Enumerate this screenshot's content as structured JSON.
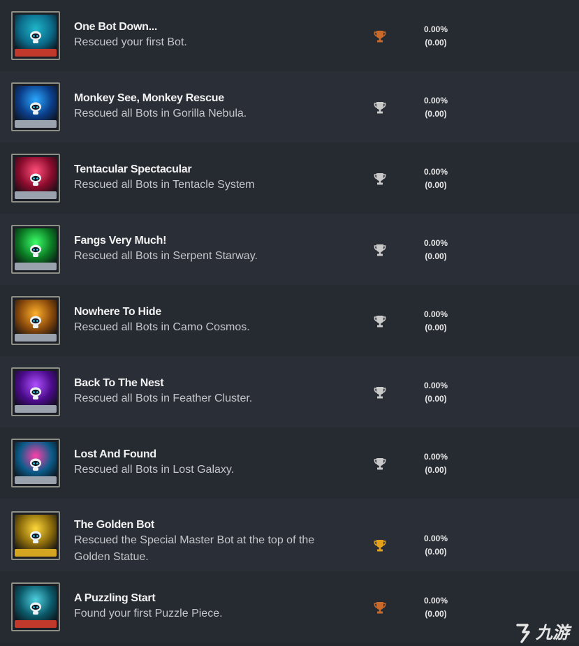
{
  "achievements": [
    {
      "title": "One Bot Down...",
      "description": "Rescued your first Bot.",
      "trophy": "bronze",
      "trophy_icon": "trophy-icon",
      "percent": "0.00%",
      "points": "(0.00)",
      "art_colors": [
        "#0b6b8a",
        "#1fb5c9"
      ],
      "base_color": "#c0392b"
    },
    {
      "title": "Monkey See, Monkey Rescue",
      "description": "Rescued all Bots in Gorilla Nebula.",
      "trophy": "silver",
      "trophy_icon": "trophy-icon",
      "percent": "0.00%",
      "points": "(0.00)",
      "art_colors": [
        "#0b3e8a",
        "#2aa8ff"
      ],
      "base_color": "#9aa3ad"
    },
    {
      "title": "Tentacular Spectacular",
      "description": "Rescued all Bots in Tentacle System",
      "trophy": "silver",
      "trophy_icon": "trophy-icon",
      "percent": "0.00%",
      "points": "(0.00)",
      "art_colors": [
        "#8a0b2c",
        "#ff4f7a"
      ],
      "base_color": "#9aa3ad"
    },
    {
      "title": "Fangs Very Much!",
      "description": "Rescued all Bots in Serpent Starway.",
      "trophy": "silver",
      "trophy_icon": "trophy-icon",
      "percent": "0.00%",
      "points": "(0.00)",
      "art_colors": [
        "#0b7a23",
        "#3cff6a"
      ],
      "base_color": "#9aa3ad"
    },
    {
      "title": "Nowhere To Hide",
      "description": "Rescued all Bots in Camo Cosmos.",
      "trophy": "silver",
      "trophy_icon": "trophy-icon",
      "percent": "0.00%",
      "points": "(0.00)",
      "art_colors": [
        "#8a4a0b",
        "#ffb02a"
      ],
      "base_color": "#9aa3ad"
    },
    {
      "title": "Back To The Nest",
      "description": "Rescued all Bots in Feather Cluster.",
      "trophy": "silver",
      "trophy_icon": "trophy-icon",
      "percent": "0.00%",
      "points": "(0.00)",
      "art_colors": [
        "#4a0b8a",
        "#b04fff"
      ],
      "base_color": "#9aa3ad"
    },
    {
      "title": "Lost And Found",
      "description": "Rescued all Bots in Lost Galaxy.",
      "trophy": "silver",
      "trophy_icon": "trophy-icon",
      "percent": "0.00%",
      "points": "(0.00)",
      "art_colors": [
        "#0b5c8a",
        "#ff3fa8"
      ],
      "base_color": "#9aa3ad"
    },
    {
      "title": "The Golden Bot",
      "description": "Rescued the Special Master Bot at the top of the Golden Statue.",
      "trophy": "gold",
      "trophy_icon": "trophy-icon",
      "percent": "0.00%",
      "points": "(0.00)",
      "art_colors": [
        "#8a6a0b",
        "#ffd83a"
      ],
      "base_color": "#d4a520"
    },
    {
      "title": "A Puzzling Start",
      "description": "Found your first Puzzle Piece.",
      "trophy": "bronze",
      "trophy_icon": "trophy-icon",
      "percent": "0.00%",
      "points": "(0.00)",
      "art_colors": [
        "#0b5a6a",
        "#4fd0e0"
      ],
      "base_color": "#c0392b"
    }
  ],
  "trophy_colors": {
    "bronze": "#c96a2b",
    "silver": "#c9c9c9",
    "gold": "#e3a21a"
  },
  "watermark": {
    "text": "九游",
    "icon": "jiuyou-logo-icon"
  }
}
